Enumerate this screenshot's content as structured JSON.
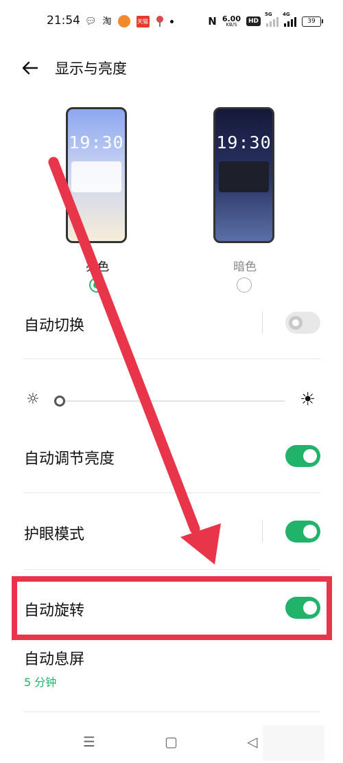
{
  "status_bar": {
    "time": "21:54",
    "wechat_icon": "wechat-icon",
    "taobao_label": "淘",
    "app_badge": "天猫",
    "speed_value": "6.00",
    "speed_unit": "KB/S",
    "hd_label": "HD",
    "signal1_label": "5G",
    "signal2_label": "4G",
    "battery": "39"
  },
  "header": {
    "back_icon": "back-arrow-icon",
    "title": "显示与亮度"
  },
  "themes": {
    "light": {
      "clock": "19:30",
      "label": "亮色",
      "selected": true
    },
    "dark": {
      "clock": "19:30",
      "label": "暗色",
      "selected": false
    }
  },
  "settings": {
    "auto_switch": {
      "label": "自动切换",
      "enabled": false
    },
    "auto_brightness": {
      "label": "自动调节亮度",
      "enabled": true
    },
    "eye_care": {
      "label": "护眼模式",
      "enabled": true
    },
    "auto_rotate": {
      "label": "自动旋转",
      "enabled": true
    },
    "screen_timeout": {
      "label": "自动息屏",
      "value": "5 分钟"
    }
  },
  "brightness": {
    "level": 0.0,
    "low_icon": "sun-low-icon",
    "high_icon": "sun-high-icon"
  },
  "annotation": {
    "color": "#e8354a",
    "target": "auto_rotate"
  },
  "colors": {
    "accent": "#22b36a",
    "annotation": "#e8354a"
  },
  "nav": {
    "menu_icon": "☰",
    "home_icon": "▢",
    "back_icon": "◁"
  }
}
